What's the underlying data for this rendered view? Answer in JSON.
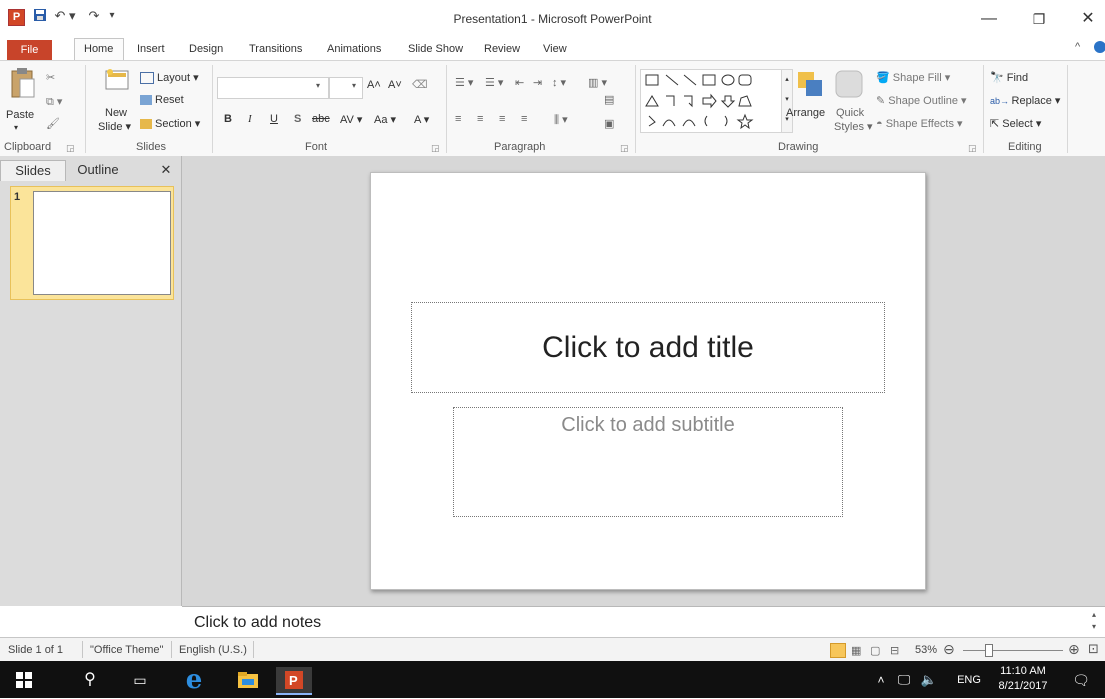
{
  "window": {
    "title": "Presentation1 - Microsoft PowerPoint",
    "app_logo": "P",
    "minimize": "—",
    "restore": "❐",
    "close": "✕"
  },
  "qat": {
    "save": "💾",
    "undo": "↶ ▾",
    "redo": "↷",
    "customize": "▾"
  },
  "tabs": [
    "File",
    "Home",
    "Insert",
    "Design",
    "Transitions",
    "Animations",
    "Slide Show",
    "Review",
    "View"
  ],
  "ribbon": {
    "clipboard": {
      "paste": "Paste",
      "label": "Clipboard"
    },
    "slides": {
      "new_slide": "New",
      "new_slide_2": "Slide ▾",
      "layout": "Layout ▾",
      "reset": "Reset",
      "section": "Section ▾",
      "label": "Slides"
    },
    "font": {
      "bold": "B",
      "italic": "I",
      "underline": "U",
      "shadow": "S",
      "strike": "abc",
      "spacing": "AV ▾",
      "case": "Aa ▾",
      "color": "A ▾",
      "grow": "A˄",
      "shrink": "A˅",
      "label": "Font"
    },
    "paragraph": {
      "label": "Paragraph"
    },
    "drawing": {
      "arrange": "Arrange",
      "quick_styles_1": "Quick",
      "quick_styles_2": "Styles ▾",
      "shape_fill": "Shape Fill ▾",
      "shape_outline": "Shape Outline ▾",
      "shape_effects": "Shape Effects ▾",
      "label": "Drawing"
    },
    "editing": {
      "find": "Find",
      "replace": "Replace ▾",
      "select": "Select ▾",
      "label": "Editing"
    }
  },
  "panel": {
    "tab_slides": "Slides",
    "tab_outline": "Outline",
    "close": "✕",
    "slide_number": "1"
  },
  "slide": {
    "title_placeholder": "Click to add title",
    "subtitle_placeholder": "Click to add subtitle"
  },
  "notes": {
    "placeholder": "Click to add notes"
  },
  "status": {
    "slide_pos": "Slide 1 of 1",
    "theme": "\"Office Theme\"",
    "language": "English (U.S.)",
    "zoom": "53%"
  },
  "taskbar": {
    "time": "11:10 AM",
    "date": "8/21/2017",
    "lang": "ENG"
  },
  "colors": {
    "accent": "#c8442a",
    "slide_selected": "#fbe49a"
  }
}
